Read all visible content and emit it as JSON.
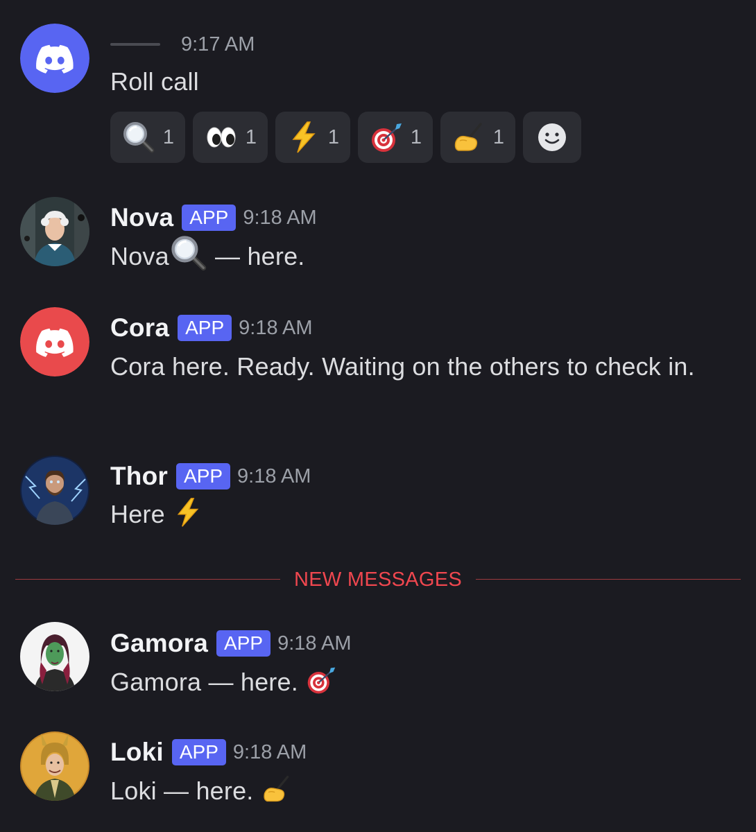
{
  "messages": [
    {
      "author": "",
      "time": "9:17 AM",
      "text": "Roll call",
      "reactions": [
        {
          "emoji": "magnifying-glass",
          "count": "1"
        },
        {
          "emoji": "eyes",
          "count": "1"
        },
        {
          "emoji": "lightning",
          "count": "1"
        },
        {
          "emoji": "dart-target",
          "count": "1"
        },
        {
          "emoji": "writing-hand",
          "count": "1"
        }
      ]
    },
    {
      "author": "Nova",
      "tag": "APP",
      "time": "9:18 AM",
      "text_before": "Nova",
      "text_after": " — here."
    },
    {
      "author": "Cora",
      "tag": "APP",
      "time": "9:18 AM",
      "text": "Cora here. Ready. Waiting on the others to check in."
    },
    {
      "author": "Thor",
      "tag": "APP",
      "time": "9:18 AM",
      "text_before": "Here "
    },
    {
      "author": "Gamora",
      "tag": "APP",
      "time": "9:18 AM",
      "text_before": "Gamora — here. "
    },
    {
      "author": "Loki",
      "tag": "APP",
      "time": "9:18 AM",
      "text_before": "Loki — here. "
    }
  ],
  "divider": {
    "label": "NEW MESSAGES"
  },
  "colors": {
    "background": "#1b1b21",
    "discord_blurple": "#5865f2",
    "discord_red": "#ed4245",
    "new_messages": "#f0474f"
  }
}
